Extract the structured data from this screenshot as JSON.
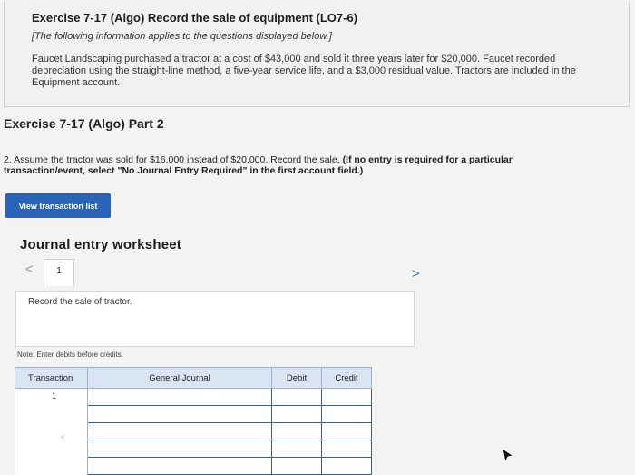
{
  "intro": {
    "title": "Exercise 7-17 (Algo) Record the sale of equipment (LO7-6)",
    "subtitle": "[The following information applies to the questions displayed below.]",
    "body": "Faucet Landscaping purchased a tractor at a cost of $43,000 and sold it three years later for $20,000. Faucet recorded depreciation using the straight-line method, a five-year service life, and a $3,000 residual value. Tractors are included in the Equipment account."
  },
  "part_title": "Exercise 7-17 (Algo) Part 2",
  "question": {
    "text": "2. Assume the tractor was sold for $16,000 instead of $20,000. Record the sale.",
    "bold": "(If no entry is required for a particular transaction/event, select \"No Journal Entry Required\" in the first account field.)"
  },
  "buttons": {
    "view_transaction_list": "View transaction list"
  },
  "worksheet": {
    "title": "Journal entry worksheet",
    "nav_prev": "<",
    "nav_next": ">",
    "active_tab": "1",
    "instruction": "Record the sale of tractor.",
    "note": "Note: Enter debits before credits."
  },
  "table": {
    "headers": {
      "transaction": "Transaction",
      "general_journal": "General Journal",
      "debit": "Debit",
      "credit": "Credit"
    },
    "transaction_number": "1",
    "transaction_mark": "<"
  }
}
